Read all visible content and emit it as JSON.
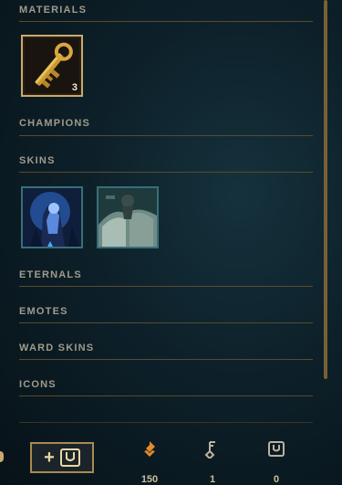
{
  "sections": {
    "materials": "MATERIALS",
    "champions": "CHAMPIONS",
    "skins": "SKINS",
    "eternals": "ETERNALS",
    "emotes": "EMOTES",
    "ward_skins": "WARD SKINS",
    "icons": "ICONS"
  },
  "materials": [
    {
      "icon": "key-fragment-icon",
      "count": "3"
    }
  ],
  "skins": [
    {
      "icon": "skin-shard-blue-icon"
    },
    {
      "icon": "skin-shard-teal-icon"
    }
  ],
  "footer": {
    "add_icon": "plus-chest-icon",
    "currencies": [
      {
        "icon": "orange-essence-icon",
        "value": "150",
        "color": "#e38a2c"
      },
      {
        "icon": "key-icon",
        "value": "1",
        "color": "#b9b39f"
      },
      {
        "icon": "chest-icon",
        "value": "0",
        "color": "#b9b39f"
      }
    ]
  },
  "colors": {
    "gold": "#c8aa6e",
    "section_text": "#a09b8c",
    "divider": "#5b4a2c"
  }
}
